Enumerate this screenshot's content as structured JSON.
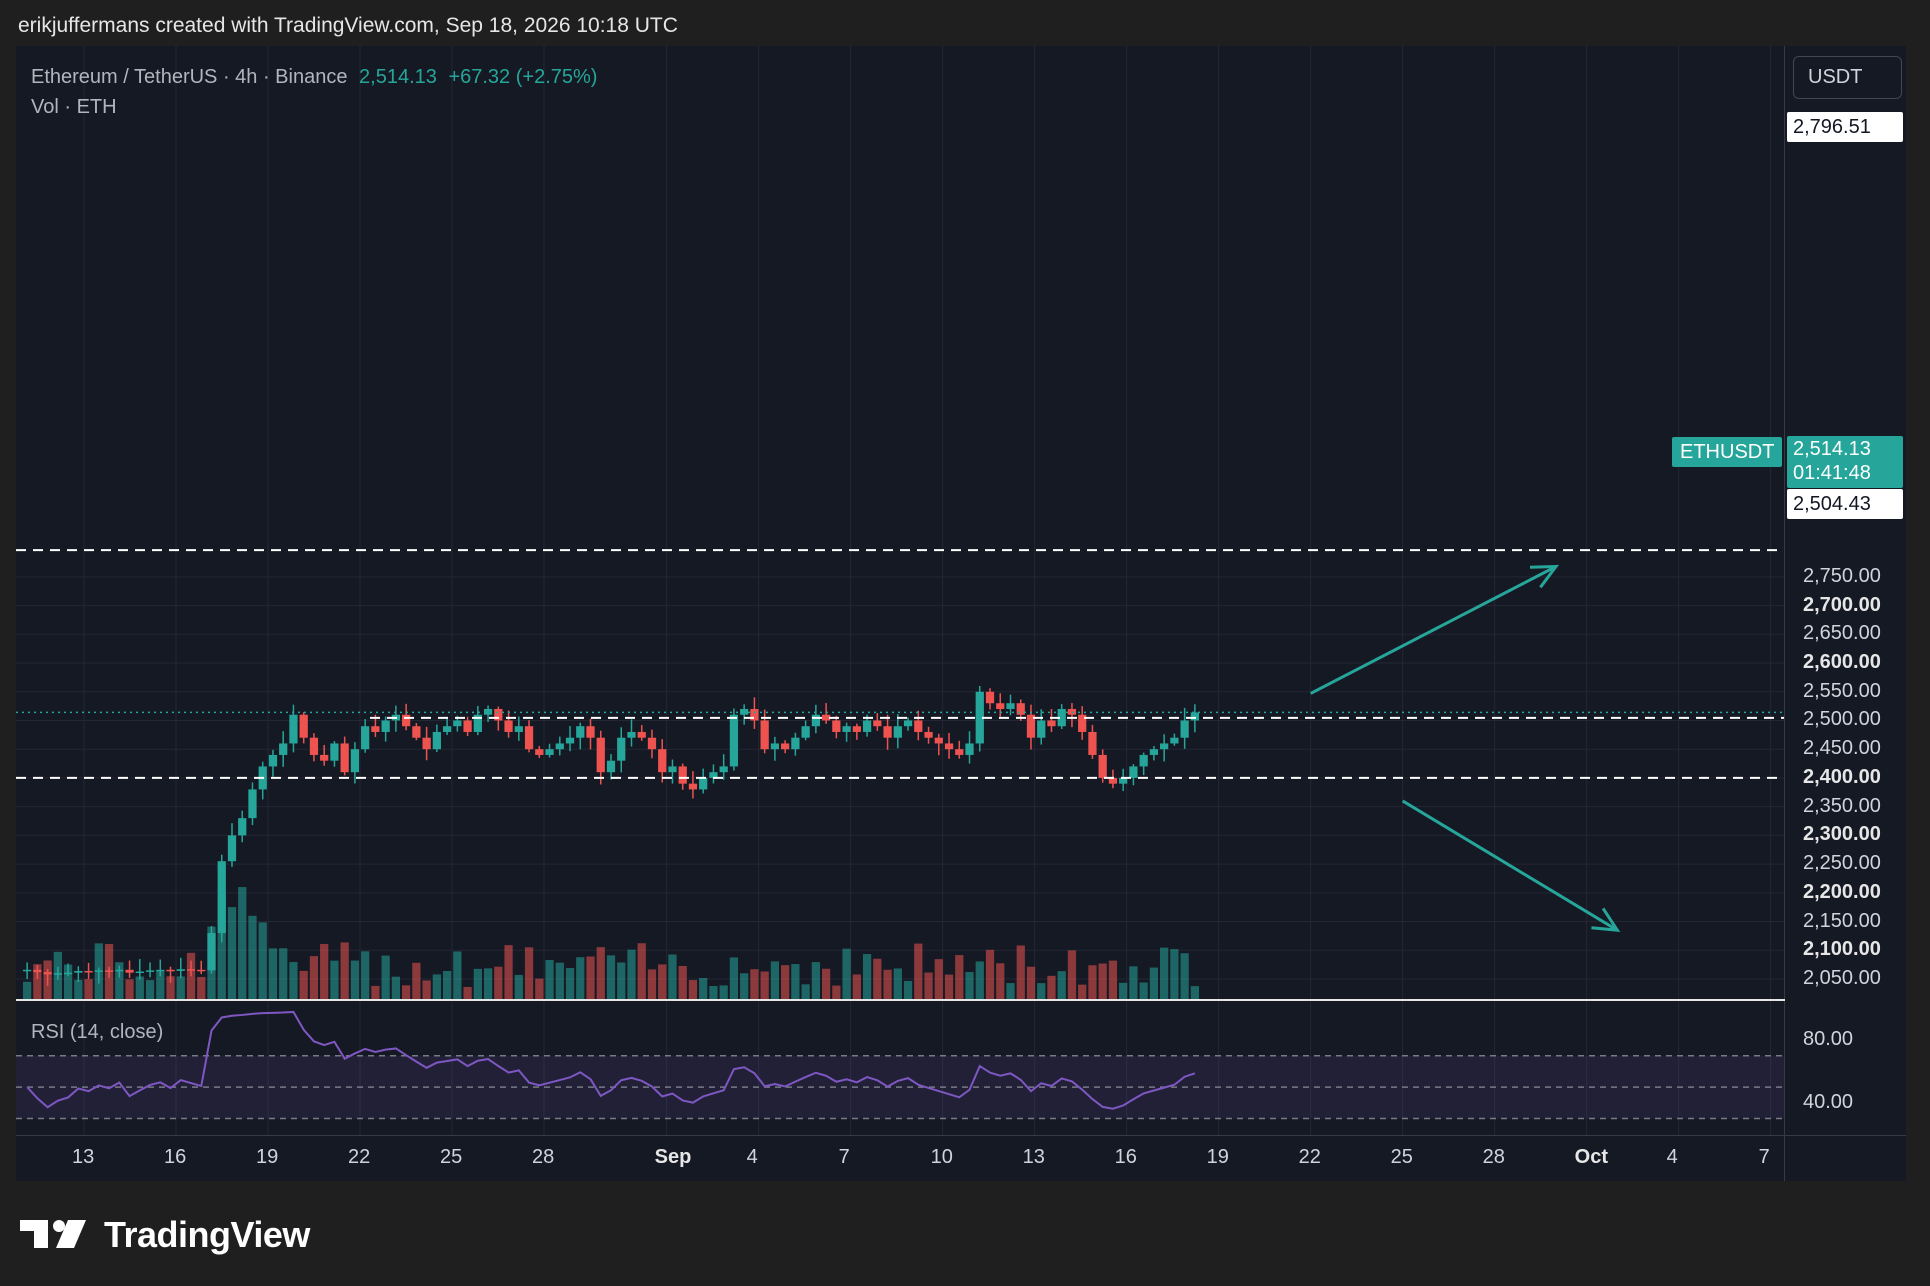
{
  "caption": "erikjuffermans created with TradingView.com, Sep 18, 2026 10:18 UTC",
  "legend": {
    "pair": "Ethereum / TetherUS · 4h · Binance",
    "last": "2,514.13",
    "change": "+67.32 (+2.75%)",
    "volume": "Vol · ETH"
  },
  "unit": "USDT",
  "symbol": "ETHUSDT",
  "rsi_label": "RSI (14, close)",
  "brand": "TradingView",
  "colors": {
    "up": "#26a69a",
    "down": "#ef5350",
    "rsi": "#7e57c2",
    "arrow": "#26a69a"
  },
  "icons": {
    "brand": "tradingview-logo-icon"
  },
  "chart_data": {
    "type": "candlestick",
    "interval": "4h",
    "y_ticks": [
      2750,
      2700,
      2650,
      2600,
      2550,
      2500,
      2450,
      2400,
      2350,
      2300,
      2250,
      2200,
      2150,
      2100,
      2050
    ],
    "y_tick_labels": [
      "2,750.00",
      "2,700.00",
      "2,650.00",
      "2,600.00",
      "2,550.00",
      "2,500.00",
      "2,450.00",
      "2,400.00",
      "2,350.00",
      "2,300.00",
      "2,250.00",
      "2,200.00",
      "2,150.00",
      "2,100.00",
      "2,050.00"
    ],
    "bold_ticks": [
      "2,700.00",
      "2,600.00",
      "2,400.00",
      "2,300.00",
      "2,200.00",
      "2,100.00"
    ],
    "ylim": [
      2035,
      2840
    ],
    "x_labels": [
      "13",
      "16",
      "19",
      "22",
      "25",
      "28",
      "Sep",
      "4",
      "7",
      "10",
      "13",
      "16",
      "19",
      "22",
      "25",
      "28",
      "Oct",
      "4",
      "7"
    ],
    "x_offsets": [
      0,
      3,
      6,
      9,
      12,
      15,
      19,
      22,
      25,
      28,
      31,
      34,
      37,
      40,
      43,
      46,
      49,
      52,
      55
    ],
    "bold_x_labels": [
      "Sep",
      "Oct"
    ],
    "markers": {
      "resistance": {
        "value": 2796.51,
        "label": "2,796.51"
      },
      "last_price": {
        "value": 2514.13,
        "label": "2,514.13",
        "countdown": "01:41:48"
      },
      "level": {
        "value": 2504.43,
        "label": "2,504.43"
      },
      "support": {
        "value": 2400.0
      }
    },
    "rsi": {
      "ylim": [
        20,
        100
      ],
      "ticks": [
        "80.00",
        "40.00"
      ],
      "tick_values": [
        80,
        40
      ],
      "bands": [
        70,
        50,
        30
      ]
    },
    "arrows": [
      {
        "from": [
          40,
          2547
        ],
        "to": [
          48,
          2768
        ],
        "direction": "up"
      },
      {
        "from": [
          43,
          2360
        ],
        "to": [
          50,
          2135
        ],
        "direction": "down"
      }
    ],
    "series": [
      {
        "name": "ETHUSDT",
        "values": [
          2066,
          2062,
          2058,
          2060,
          2061,
          2064,
          2063,
          2065,
          2064,
          2066,
          2061,
          2063,
          2065,
          2066,
          2064,
          2067,
          2066,
          2065,
          2130,
          2255,
          2300,
          2330,
          2380,
          2420,
          2440,
          2460,
          2510,
          2470,
          2440,
          2430,
          2460,
          2410,
          2450,
          2490,
          2480,
          2500,
          2510,
          2490,
          2470,
          2450,
          2480,
          2490,
          2500,
          2480,
          2510,
          2520,
          2500,
          2480,
          2490,
          2450,
          2440,
          2450,
          2460,
          2470,
          2490,
          2470,
          2410,
          2430,
          2470,
          2480,
          2470,
          2450,
          2410,
          2420,
          2390,
          2380,
          2400,
          2410,
          2420,
          2510,
          2520,
          2500,
          2450,
          2460,
          2450,
          2470,
          2490,
          2510,
          2500,
          2480,
          2490,
          2480,
          2500,
          2490,
          2470,
          2490,
          2500,
          2480,
          2470,
          2460,
          2450,
          2440,
          2460,
          2550,
          2530,
          2520,
          2530,
          2510,
          2470,
          2500,
          2490,
          2520,
          2510,
          2480,
          2440,
          2400,
          2390,
          2400,
          2420,
          2440,
          2450,
          2460,
          2470,
          2500,
          2514
        ]
      }
    ]
  }
}
